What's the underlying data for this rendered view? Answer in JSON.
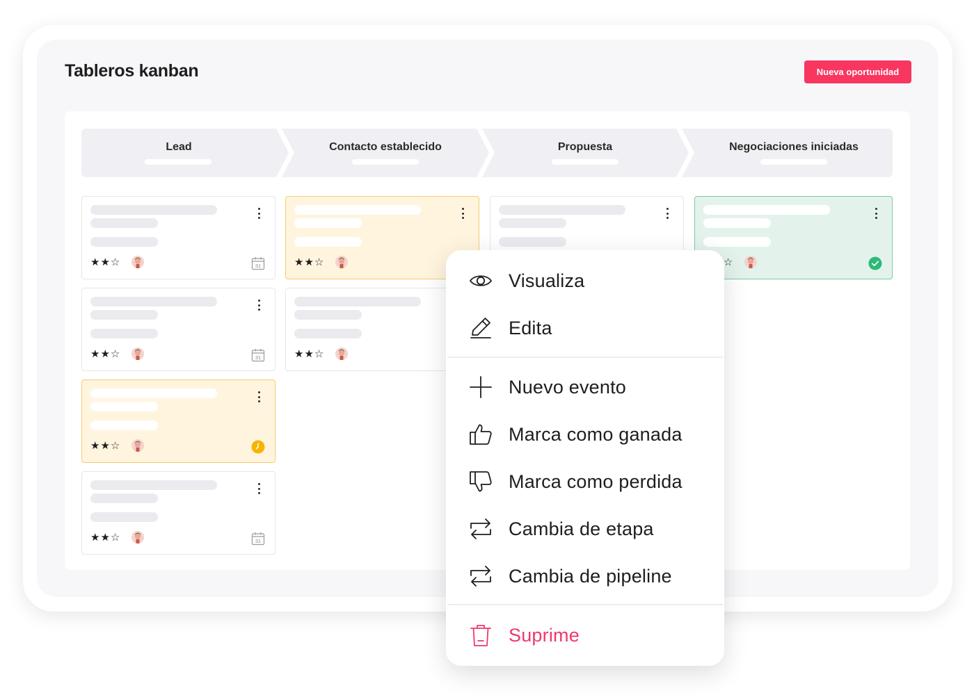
{
  "page": {
    "title": "Tableros kanban"
  },
  "header": {
    "new_button_label": "Nueva oportunidad"
  },
  "colors": {
    "accent": "#f83660",
    "danger": "#f0386b",
    "warning_card": "#fff4de",
    "success_card": "#e3f3ec",
    "success_check": "#2db97a",
    "pending_clock": "#f5b500"
  },
  "pipeline": {
    "stages": [
      {
        "label": "Lead"
      },
      {
        "label": "Contacto establecido"
      },
      {
        "label": "Propuesta"
      },
      {
        "label": "Negociaciones iniciadas"
      }
    ]
  },
  "cards": {
    "lead": [
      {
        "style": "default",
        "rating": 2,
        "icon": "calendar-icon",
        "calendar_day": "31"
      },
      {
        "style": "default",
        "rating": 2,
        "icon": "calendar-icon",
        "calendar_day": "31"
      },
      {
        "style": "warning",
        "rating": 2,
        "icon": "clock-icon"
      },
      {
        "style": "default",
        "rating": 2,
        "icon": "calendar-icon",
        "calendar_day": "31"
      }
    ],
    "contacto": [
      {
        "style": "warning",
        "rating": 2
      },
      {
        "style": "default",
        "rating": 2
      }
    ],
    "propuesta": [
      {
        "style": "default",
        "rating": 2
      }
    ],
    "negociaciones": [
      {
        "style": "success",
        "rating": 2,
        "icon": "check-circle-icon"
      }
    ],
    "stars_text": "★★☆"
  },
  "context_menu": {
    "items": [
      {
        "label": "Visualiza",
        "icon": "eye-icon"
      },
      {
        "label": "Edita",
        "icon": "pencil-icon"
      },
      {
        "label": "Nuevo evento",
        "icon": "plus-icon"
      },
      {
        "label": "Marca como ganada",
        "icon": "thumbs-up-icon"
      },
      {
        "label": "Marca como perdida",
        "icon": "thumbs-down-icon"
      },
      {
        "label": "Cambia de etapa",
        "icon": "swap-arrows-icon"
      },
      {
        "label": "Cambia de pipeline",
        "icon": "swap-arrows-icon"
      },
      {
        "label": "Suprime",
        "icon": "trash-icon"
      }
    ]
  }
}
